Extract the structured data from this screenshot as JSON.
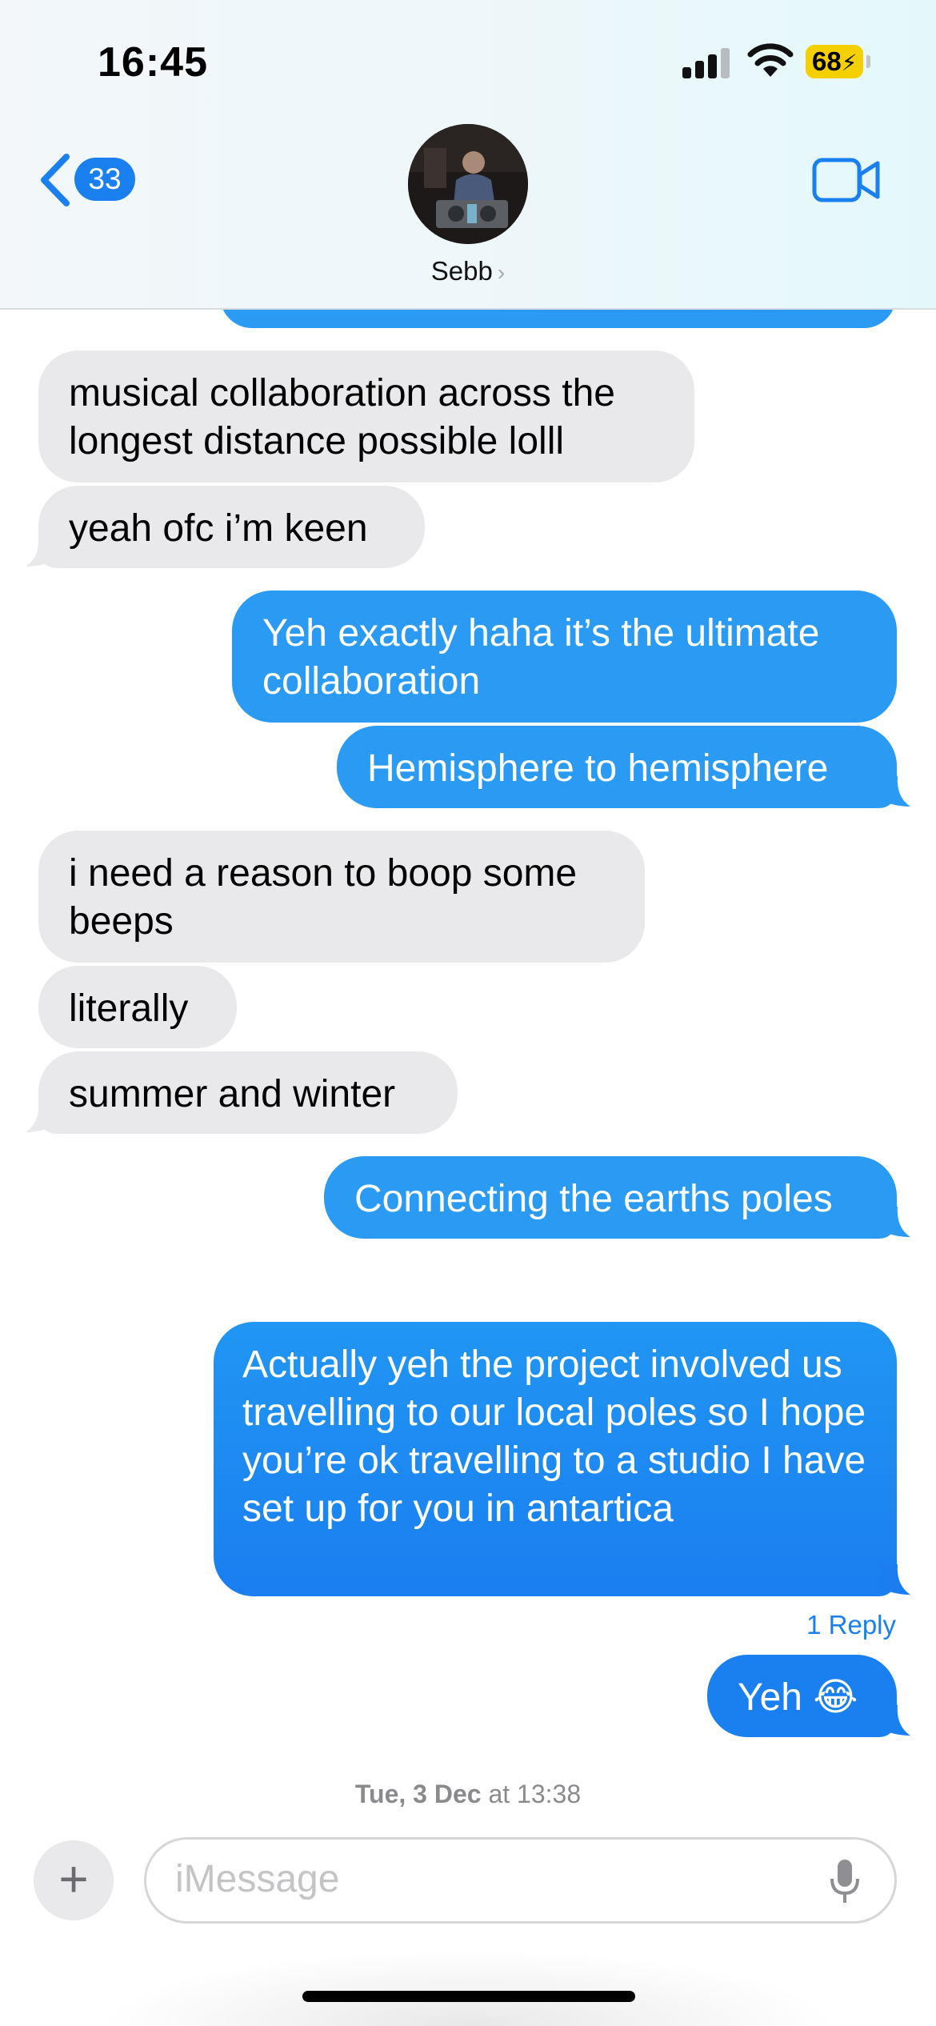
{
  "status_bar": {
    "time": "16:45",
    "battery": "68"
  },
  "header": {
    "back_count": "33",
    "contact_name": "Sebb",
    "icons": [
      "chevron-left-icon",
      "video-camera-icon",
      "chevron-right-icon"
    ]
  },
  "messages": [
    {
      "from": "them",
      "text": "musical collaboration across the longest distance possible lolll"
    },
    {
      "from": "them",
      "text": "yeah ofc i’m keen"
    },
    {
      "from": "me",
      "text": "Yeh exactly haha it’s the ultimate collaboration"
    },
    {
      "from": "me",
      "text": "Hemisphere to hemisphere"
    },
    {
      "from": "them",
      "text": "i need a reason to boop some beeps"
    },
    {
      "from": "them",
      "text": "literally"
    },
    {
      "from": "them",
      "text": "summer and winter"
    },
    {
      "from": "me",
      "text": "Connecting the earths poles"
    },
    {
      "from": "me",
      "text": "Actually yeh the project involved us travelling to our local poles so I hope you’re ok travelling to a studio I have set up for you in antartica"
    },
    {
      "from": "me",
      "text": "Yeh 😂"
    }
  ],
  "reply_link": "1 Reply",
  "timestamp": {
    "day": "Tue, 3 Dec",
    "time": " at 13:38"
  },
  "composer": {
    "placeholder": "iMessage"
  },
  "colors": {
    "accent": "#1a7fef",
    "outgoing": "#2b9af3",
    "incoming": "#e9e9eb",
    "battery": "#f5d000"
  }
}
